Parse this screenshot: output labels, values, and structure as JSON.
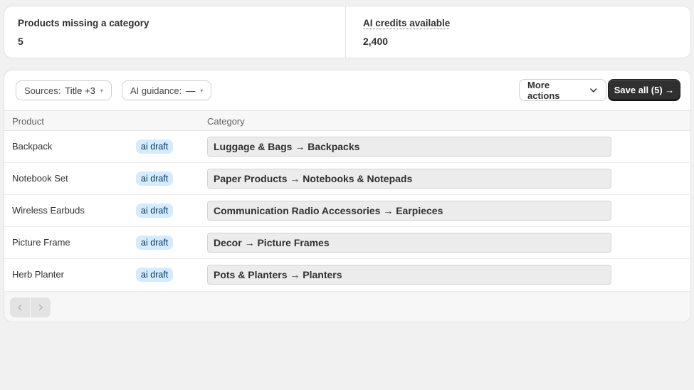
{
  "stats": {
    "missing_label": "Products missing a category",
    "missing_value": "5",
    "credits_label": "AI credits available",
    "credits_value": "2,400"
  },
  "toolbar": {
    "sources_label": "Sources:",
    "sources_value": "Title +3",
    "guidance_label": "AI guidance:",
    "guidance_value": "—",
    "more_actions_label": "More actions",
    "save_all_label": "Save all (5) →"
  },
  "table": {
    "headers": {
      "product": "Product",
      "category": "Category"
    },
    "rows": [
      {
        "product": "Backpack",
        "badge": "ai draft",
        "category": "Luggage & Bags → Backpacks"
      },
      {
        "product": "Notebook Set",
        "badge": "ai draft",
        "category": "Paper Products → Notebooks & Notepads"
      },
      {
        "product": "Wireless Earbuds",
        "badge": "ai draft",
        "category": "Communication Radio Accessories → Earpieces"
      },
      {
        "product": "Picture Frame",
        "badge": "ai draft",
        "category": "Decor → Picture Frames"
      },
      {
        "product": "Herb Planter",
        "badge": "ai draft",
        "category": "Pots & Planters → Planters"
      }
    ]
  },
  "pagination": {
    "prev_icon": "chevron-left-icon",
    "next_icon": "chevron-right-icon"
  }
}
